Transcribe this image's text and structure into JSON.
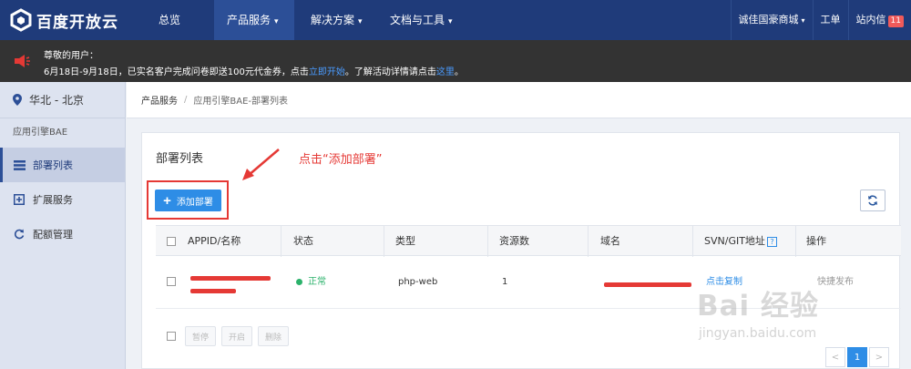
{
  "topnav": {
    "logo_text": "百度开放云",
    "items": [
      {
        "label": "总览",
        "caret": ""
      },
      {
        "label": "产品服务",
        "caret": "▾"
      },
      {
        "label": "解决方案",
        "caret": "▾"
      },
      {
        "label": "文档与工具",
        "caret": "▾"
      }
    ],
    "right": {
      "store": "诚佳国豪商城",
      "store_caret": "▾",
      "ticket": "工单",
      "messages": "站内信",
      "messages_badge": "11"
    }
  },
  "notice": {
    "line1": "尊敬的用户：",
    "line2_prefix": "6月18日-9月18日，已实名客户完成问卷即送100元代金券，点击",
    "line2_link1": "立即开始",
    "line2_mid": "。了解活动详情请点击",
    "line2_link2": "这里",
    "line2_end": "。"
  },
  "sidebar": {
    "region": "华北 - 北京",
    "section_title": "应用引擎BAE",
    "items": [
      {
        "label": "部署列表",
        "icon": "list-icon"
      },
      {
        "label": "扩展服务",
        "icon": "plus-box-icon"
      },
      {
        "label": "配额管理",
        "icon": "refresh-icon"
      }
    ]
  },
  "breadcrumb": {
    "root": "产品服务",
    "separator": "/",
    "current": "应用引擎BAE-部署列表"
  },
  "panel": {
    "title": "部署列表",
    "add_button": "添加部署",
    "annotation": "点击“添加部署”",
    "columns": [
      "APPID/名称",
      "状态",
      "类型",
      "资源数",
      "域名",
      "SVN/GIT地址",
      "操作"
    ],
    "help_mark": "?",
    "rows": [
      {
        "status": "正常",
        "type": "php-web",
        "resources": "1",
        "svn_action": "点击复制",
        "operation": "快捷发布"
      }
    ],
    "bulk_buttons": [
      "暂停",
      "开启",
      "删除"
    ],
    "pager": {
      "prev": "<",
      "current": "1",
      "next": ">"
    }
  },
  "watermark": {
    "text": "Bai 经验",
    "sub": "jingyan.baidu.com"
  },
  "colors": {
    "nav_bg": "#1f3b7a",
    "primary": "#2e8de6",
    "success": "#2bb26b",
    "annotation_red": "#e53935"
  }
}
